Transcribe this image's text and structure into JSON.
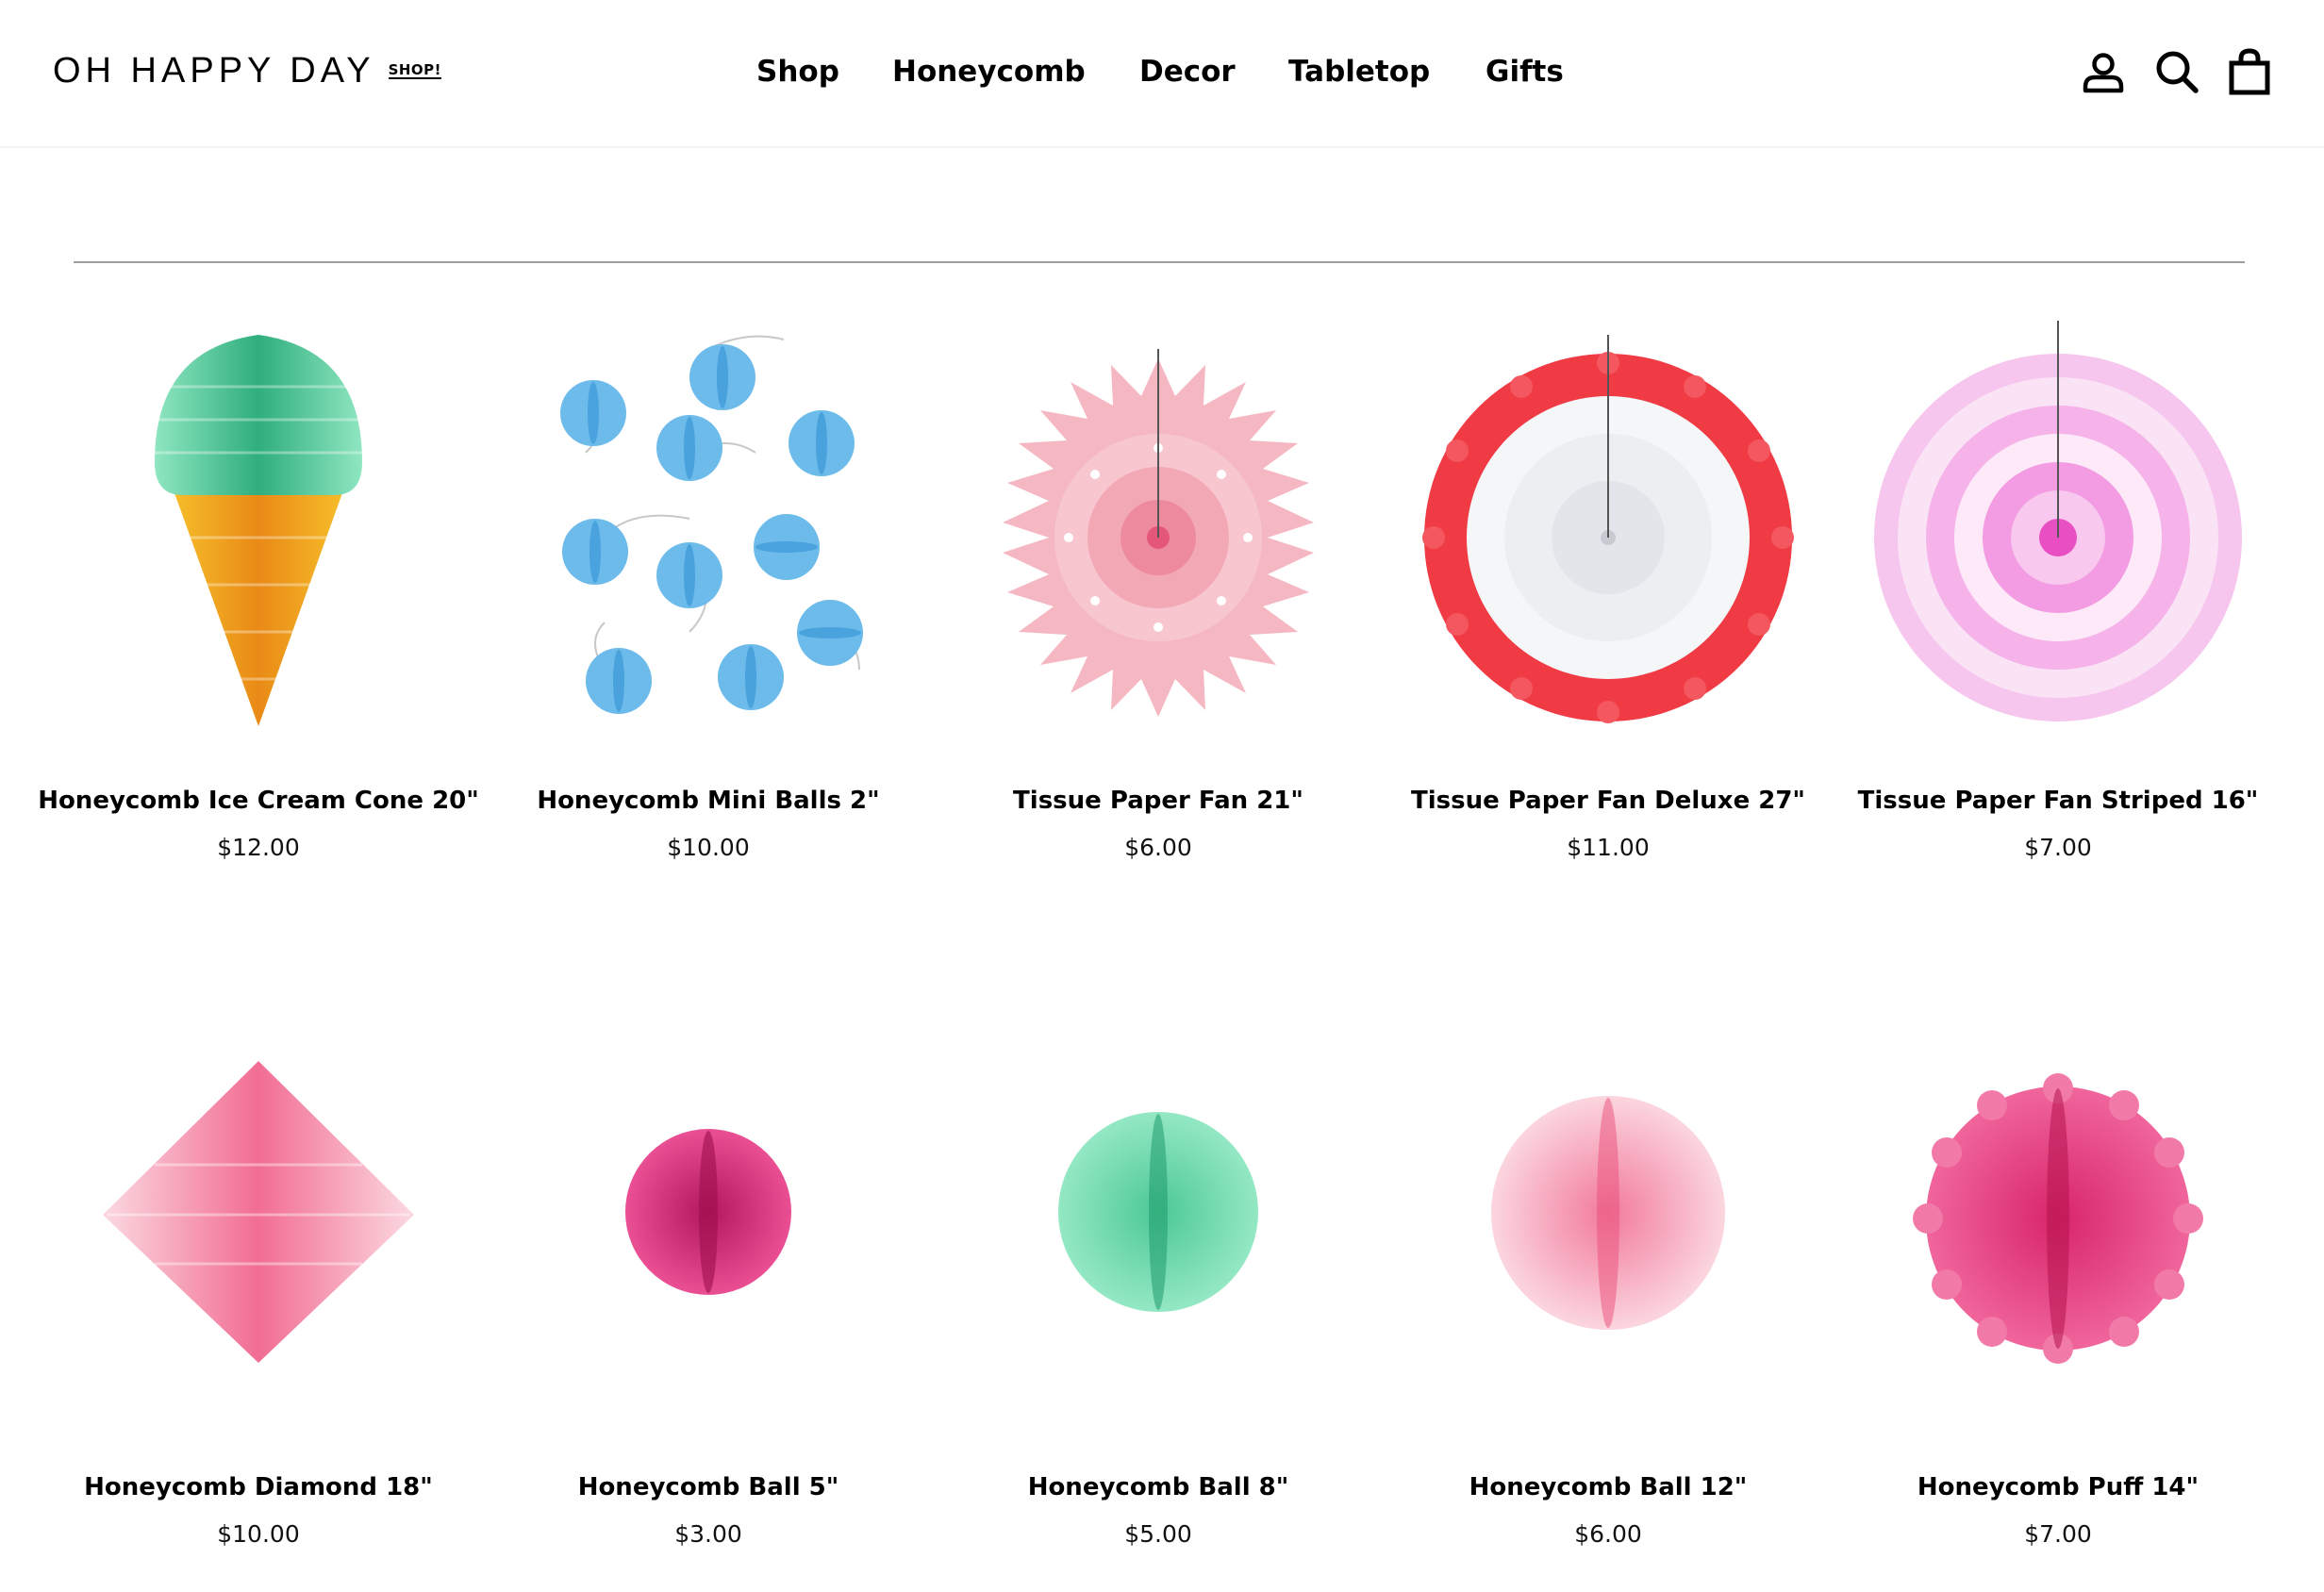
{
  "brand": {
    "name": "OH HAPPY DAY",
    "tag": "SHOP!"
  },
  "nav": [
    "Shop",
    "Honeycomb",
    "Decor",
    "Tabletop",
    "Gifts"
  ],
  "icons": [
    "account-icon",
    "search-icon",
    "cart-icon"
  ],
  "products": [
    {
      "name": "Honeycomb Ice Cream Cone 20\"",
      "price": "$12.00"
    },
    {
      "name": "Honeycomb Mini Balls 2\"",
      "price": "$10.00"
    },
    {
      "name": "Tissue Paper Fan 21\"",
      "price": "$6.00"
    },
    {
      "name": "Tissue Paper Fan Deluxe 27\"",
      "price": "$11.00"
    },
    {
      "name": "Tissue Paper Fan Striped 16\"",
      "price": "$7.00"
    },
    {
      "name": "Honeycomb Diamond 18\"",
      "price": "$10.00"
    },
    {
      "name": "Honeycomb Ball 5\"",
      "price": "$3.00"
    },
    {
      "name": "Honeycomb Ball 8\"",
      "price": "$5.00"
    },
    {
      "name": "Honeycomb Ball 12\"",
      "price": "$6.00"
    },
    {
      "name": "Honeycomb Puff 14\"",
      "price": "$7.00"
    }
  ]
}
